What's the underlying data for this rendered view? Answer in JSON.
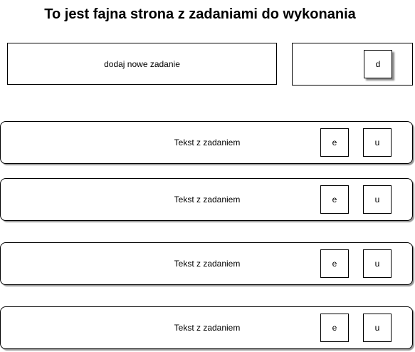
{
  "header": {
    "title": "To jest fajna strona z zadaniami do wykonania"
  },
  "add_form": {
    "input_text": "dodaj nowe zadanie",
    "add_button_label": "d"
  },
  "tasks": [
    {
      "text": "Tekst z zadaniem",
      "edit_label": "e",
      "delete_label": "u"
    },
    {
      "text": "Tekst z zadaniem",
      "edit_label": "e",
      "delete_label": "u"
    },
    {
      "text": "Tekst z zadaniem",
      "edit_label": "e",
      "delete_label": "u"
    },
    {
      "text": "Tekst z zadaniem",
      "edit_label": "e",
      "delete_label": "u"
    }
  ]
}
